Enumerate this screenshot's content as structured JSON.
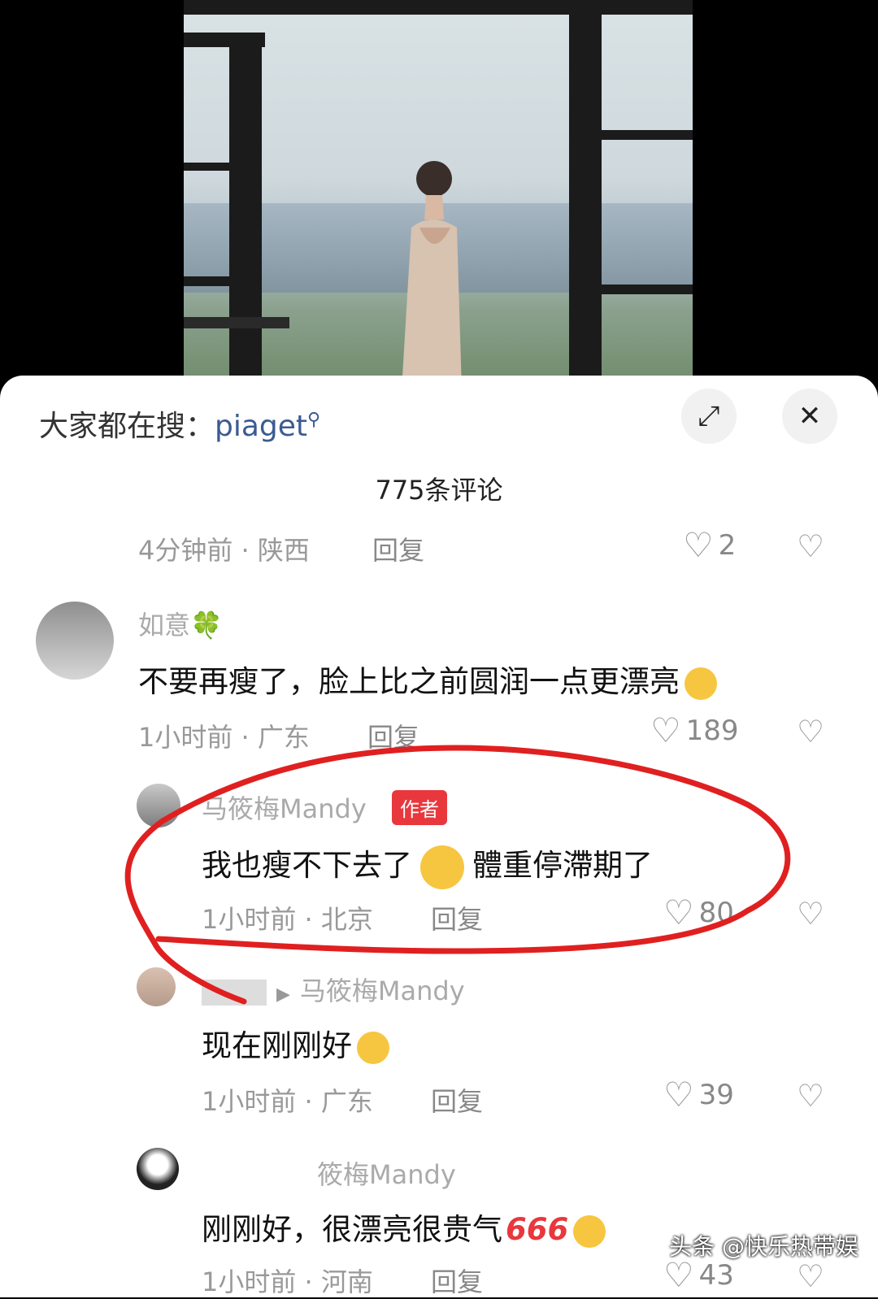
{
  "search": {
    "prefix": "大家都在搜：",
    "keyword": "piaget"
  },
  "comment_count": "775条评论",
  "comments": [
    {
      "meta": "4分钟前 · 陕西",
      "reply": "回复",
      "likes": "2"
    },
    {
      "name": "如意🍀",
      "text": "不要再瘦了，脸上比之前圆润一点更漂亮",
      "meta": "1小时前 · 广东",
      "reply": "回复",
      "likes": "189"
    },
    {
      "name": "马筱梅Mandy",
      "badge": "作者",
      "text_a": "我也瘦不下去了",
      "text_b": "體重停滯期了",
      "meta": "1小时前 · 北京",
      "reply": "回复",
      "likes": "80"
    },
    {
      "reply_to": "马筱梅Mandy",
      "text": "现在刚刚好",
      "meta": "1小时前 · 广东",
      "reply": "回复",
      "likes": "39"
    },
    {
      "name": "筱梅Mandy",
      "text": "刚刚好，很漂亮很贵气",
      "emoji_text": "666",
      "meta": "1小时前 · 河南",
      "reply": "回复",
      "likes": "43"
    }
  ],
  "watermark": "头条 @快乐热带娱",
  "colors": {
    "accent_keyword": "#3b5b92",
    "badge": "#e8383d",
    "annotation": "#e02020"
  }
}
